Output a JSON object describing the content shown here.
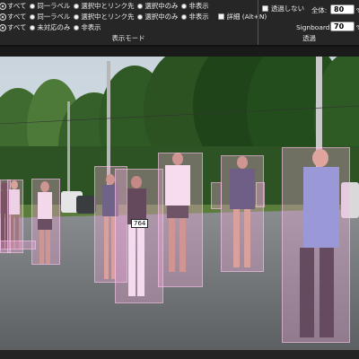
{
  "display_mode": {
    "section_label": "表示モード",
    "rows": [
      [
        {
          "label": "すべて",
          "kind": "radio",
          "checked": true
        },
        {
          "label": "同一ラベル",
          "kind": "radio",
          "checked": false
        },
        {
          "label": "選択中とリンク先",
          "kind": "radio",
          "checked": false
        },
        {
          "label": "選択中のみ",
          "kind": "radio",
          "checked": false
        },
        {
          "label": "非表示",
          "kind": "radio",
          "checked": false
        }
      ],
      [
        {
          "label": "すべて",
          "kind": "radio",
          "checked": true
        },
        {
          "label": "同一ラベル",
          "kind": "radio",
          "checked": false
        },
        {
          "label": "選択中とリンク先",
          "kind": "radio",
          "checked": false
        },
        {
          "label": "選択中のみ",
          "kind": "radio",
          "checked": false
        },
        {
          "label": "非表示",
          "kind": "radio",
          "checked": false
        },
        {
          "label": "詳細 (Alt+N)",
          "kind": "checkbox",
          "checked": false
        }
      ],
      [
        {
          "label": "すべて",
          "kind": "radio",
          "checked": true
        },
        {
          "label": "未対応のみ",
          "kind": "radio",
          "checked": false
        },
        {
          "label": "非表示",
          "kind": "radio",
          "checked": false
        }
      ]
    ]
  },
  "transparency": {
    "section_label": "透過",
    "no_transparency_label": "透過しない",
    "no_transparency_checked": false,
    "overall_label": "全体:",
    "overall_value": "80",
    "signboard_label": "Signboard:",
    "signboard_value": "70",
    "unit": "%"
  },
  "scene": {
    "box_color": "#ffb0e6",
    "annotations": [
      {
        "bib": "",
        "kind": "runner"
      },
      {
        "bib": "",
        "kind": "runner"
      },
      {
        "bib": "",
        "kind": "runner"
      },
      {
        "bib": "",
        "kind": "runner"
      },
      {
        "bib": "",
        "kind": "runner"
      },
      {
        "bib": "764",
        "kind": "runner"
      },
      {
        "bib": "",
        "kind": "runner"
      },
      {
        "bib": "",
        "kind": "runner"
      },
      {
        "bib": "",
        "kind": "runner"
      },
      {
        "bib": "",
        "kind": "runner"
      },
      {
        "bib": "",
        "kind": "runner"
      }
    ]
  }
}
